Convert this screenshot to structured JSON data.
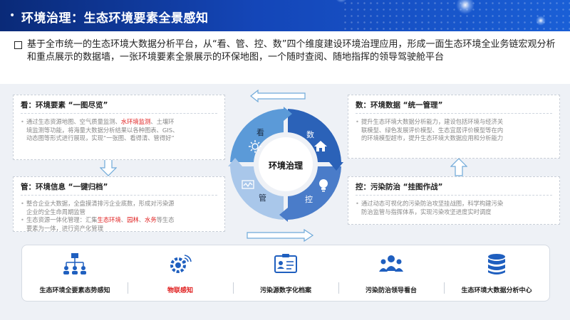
{
  "header": {
    "title": "环境治理：生态环境要素全景感知"
  },
  "intro": {
    "text": "基于全市统一的生态环境大数据分析平台，从“看、管、控、数”四个维度建设环境治理应用，形成一面生态环境全业务链宏观分析和重点展示的数据墙，一张环境要素全景展示的环保地图，一个随时查阅、随地指挥的领导驾驶舱平台"
  },
  "center": {
    "label": "环境治理",
    "segments": {
      "kan": "看",
      "shu": "数",
      "kong": "控",
      "guan": "管"
    }
  },
  "cards": {
    "kan": {
      "title": "看：环境要素 “一图尽览”",
      "line1_a": "通过生态资源地图、空气质量监测、",
      "line1_red": "水环境监测",
      "line1_b": "、土壤环",
      "line2": "境监测等功能，将海量大数据分析结果以各种图表、GIS、",
      "line3": "动态图等形式进行展现，实现“一张图、看得清、管得好”"
    },
    "guan": {
      "title": "管：环境信息 “一键归档”",
      "b1_l1": "整合企业大数据，全盘摸清排污企业底数，形成对污染源",
      "b1_l2": "企业的全生命周期监管",
      "b2_a": "生态资源一体化管理：汇集",
      "b2_r1": "生态环境",
      "b2_s1": "、",
      "b2_r2": "园林",
      "b2_s2": "、",
      "b2_r3": "水务",
      "b2_b": "等生态",
      "b2_l2": "要素为一体，进行资产化管理"
    },
    "shu": {
      "title": "数：环境数据 “统一管理”",
      "l1": "提升生态环境大数据分析能力，建设包括环境与经济关",
      "l2": "联模型、绿色发展评价模型、生态宜居评价模型等在内",
      "l3": "的环境模型超市，提升生态环境大数据应用和分析能力"
    },
    "kong": {
      "title": "控：污染防治 “挂图作战”",
      "l1": "通过动态可视化的污染防治攻坚挂战图，科学构建污染",
      "l2": "防治监管与指挥体系，实现污染攻坚进度实时调度"
    }
  },
  "bottom": {
    "items": [
      {
        "label": "生态环境全要素态势感知",
        "icon": "hierarchy-icon"
      },
      {
        "label": "物联感知",
        "icon": "iot-gear-icon"
      },
      {
        "label": "污染源数字化档案",
        "icon": "id-card-icon"
      },
      {
        "label": "污染防治领导看台",
        "icon": "people-icon"
      },
      {
        "label": "生态环境大数据分析中心",
        "icon": "database-icon"
      }
    ]
  },
  "colors": {
    "header_dark": "#0a2a78",
    "header_light": "#1a5fd6",
    "segment_kan": "#5b9ad8",
    "segment_shu": "#2b62b8",
    "segment_kong": "#4a7cc9",
    "segment_guan": "#a9c7ea",
    "accent_red": "#e02020"
  }
}
